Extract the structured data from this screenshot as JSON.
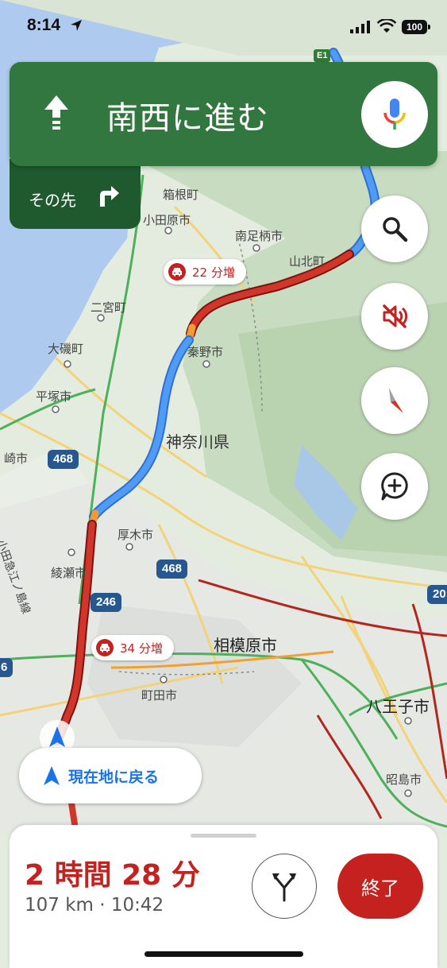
{
  "status_bar": {
    "time": "8:14",
    "battery": "100"
  },
  "navigation": {
    "instruction": "南西に進む",
    "then_label": "その先"
  },
  "map": {
    "labels": {
      "hakone": "箱根町",
      "odawara": "小田原市",
      "minamiashigara": "南足柄市",
      "yamakita": "山北町",
      "ninomiya": "二宮町",
      "oiso": "大磯町",
      "hadano": "秦野市",
      "hiratsuka": "平塚市",
      "chigasaki": "崎市",
      "kanagawa": "神奈川県",
      "atsugi": "厚木市",
      "ayase": "綾瀬市",
      "odakyu": "小田急江ノ島線",
      "sagamihara": "相模原市",
      "machida": "町田市",
      "hachioji": "八王子市",
      "akishima": "昭島市"
    },
    "shields": {
      "r468_left": "468",
      "r468_mid": "468",
      "r246": "246",
      "r20": "20",
      "r6": "6",
      "e1": "E1"
    },
    "traffic_callouts": [
      {
        "text": "22 分増"
      },
      {
        "text": "34 分増"
      }
    ]
  },
  "controls": {
    "recenter_label": "現在地に戻る"
  },
  "trip": {
    "eta": "2 時間 28 分",
    "details": "107 km · 10:42",
    "end_label": "終了"
  },
  "colors": {
    "nav_green": "#32773f",
    "nav_dark_green": "#1e5a2d",
    "traffic_red": "#c5221f",
    "route_blue": "#4285f4",
    "link_blue": "#1a73e8"
  }
}
